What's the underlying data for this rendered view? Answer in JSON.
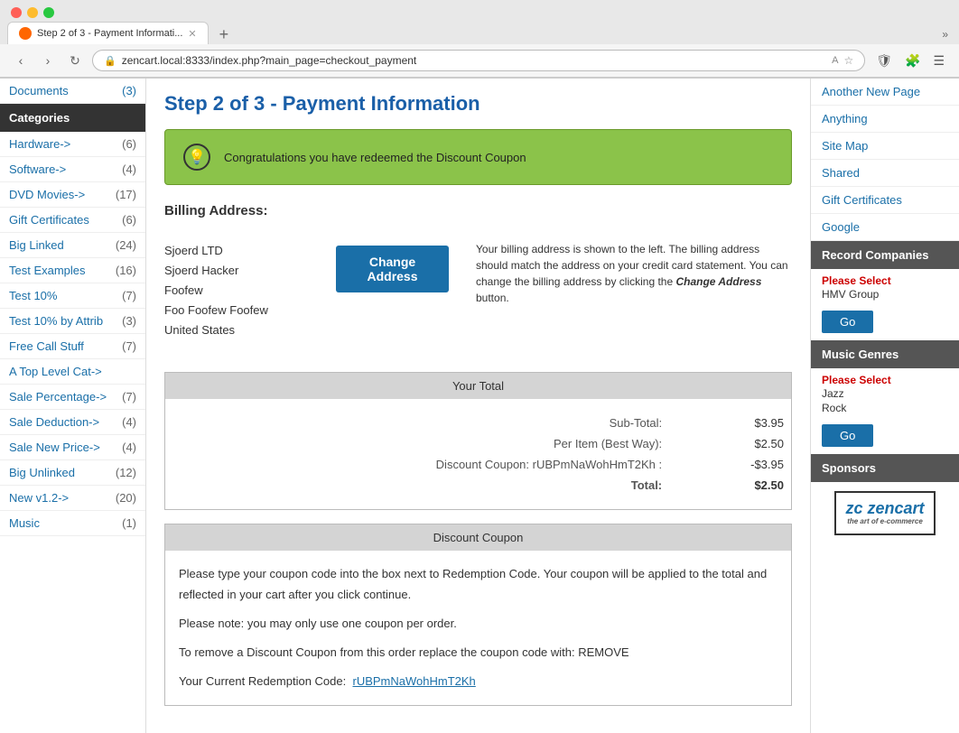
{
  "browser": {
    "tab_label": "Step 2 of 3 - Payment Informati...",
    "url": "zencart.local:8333/index.php?main_page=checkout_payment",
    "new_tab": "+",
    "tab_overflow": "»"
  },
  "left_sidebar": {
    "top_item": {
      "label": "Documents",
      "count": "(3)"
    },
    "categories_header": "Categories",
    "items": [
      {
        "name": "Hardware->",
        "count": "(6)"
      },
      {
        "name": "Software->",
        "count": "(4)"
      },
      {
        "name": "DVD Movies->",
        "count": "(17)"
      },
      {
        "name": "Gift Certificates",
        "count": "(6)"
      },
      {
        "name": "Big Linked",
        "count": "(24)"
      },
      {
        "name": "Test Examples",
        "count": "(16)"
      },
      {
        "name": "Test 10%",
        "count": "(7)"
      },
      {
        "name": "Test 10% by Attrib",
        "count": "(3)"
      },
      {
        "name": "Free Call Stuff",
        "count": "(7)"
      },
      {
        "name": "A Top Level Cat->",
        "count": ""
      },
      {
        "name": "Sale Percentage->",
        "count": "(7)"
      },
      {
        "name": "Sale Deduction->",
        "count": "(4)"
      },
      {
        "name": "Sale New Price->",
        "count": "(4)"
      },
      {
        "name": "Big Unlinked",
        "count": "(12)"
      },
      {
        "name": "New v1.2->",
        "count": "(20)"
      },
      {
        "name": "Music",
        "count": "(1)"
      }
    ]
  },
  "main": {
    "page_title": "Step 2 of 3 - Payment Information",
    "success_banner": "Congratulations you have redeemed the Discount Coupon",
    "billing": {
      "header": "Billing Address:",
      "address_lines": [
        "Sjoerd LTD",
        "Sjoerd Hacker",
        "Foofew",
        "Foo Foofew Foofew",
        "United States"
      ],
      "change_btn": "Change Address",
      "note": "Your billing address is shown to the left. The billing address should match the address on your credit card statement. You can change the billing address by clicking the Change Address button."
    },
    "totals": {
      "header": "Your Total",
      "rows": [
        {
          "label": "Sub-Total:",
          "value": "$3.95"
        },
        {
          "label": "Per Item (Best Way):",
          "value": "$2.50"
        },
        {
          "label": "Discount Coupon: rUBPmNaWohHmT2Kh :",
          "value": "-$3.95"
        },
        {
          "label": "Total:",
          "value": "$2.50"
        }
      ]
    },
    "coupon": {
      "header": "Discount Coupon",
      "text1": "Please type your coupon code into the box next to Redemption Code. Your coupon will be applied to the total and reflected in your cart after you click continue.",
      "text2": "Please note: you may only use one coupon per order.",
      "text3": "To remove a Discount Coupon from this order replace the coupon code with: REMOVE",
      "text4": "Your Current Redemption Code:",
      "current_code": "rUBPmNaWohHmT2Kh"
    }
  },
  "right_sidebar": {
    "links": [
      {
        "label": "Another New Page"
      },
      {
        "label": "Anything"
      },
      {
        "label": "Site Map"
      },
      {
        "label": "Shared"
      },
      {
        "label": "Gift Certificates"
      },
      {
        "label": "Google"
      }
    ],
    "record_companies": {
      "header": "Record Companies",
      "select_label": "Please Select",
      "options": [
        "HMV Group"
      ],
      "go_btn": "Go"
    },
    "music_genres": {
      "header": "Music Genres",
      "select_label": "Please Select",
      "options": [
        "Jazz",
        "Rock"
      ],
      "go_btn": "Go"
    },
    "sponsors": {
      "header": "Sponsors",
      "logo_text": "zencart",
      "logo_tagline": "the art of e-commerce"
    }
  }
}
